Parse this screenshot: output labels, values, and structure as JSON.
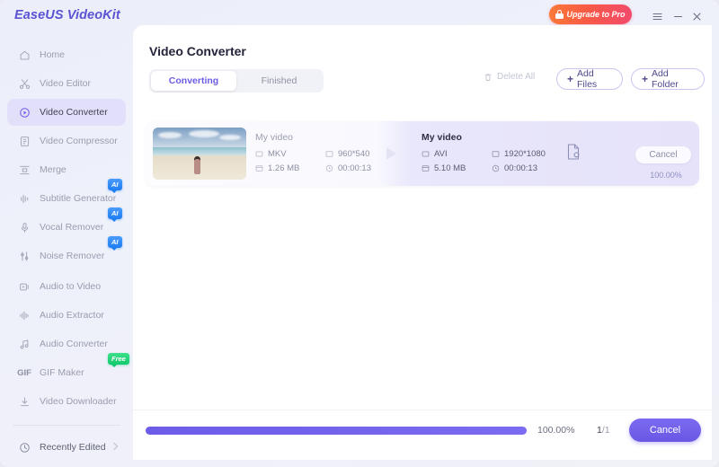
{
  "app": {
    "logo": "EaseUS VideoKit",
    "upgrade_label": "Upgrade to Pro"
  },
  "window_controls": {
    "menu": "menu-icon",
    "minimize": "minimize-icon",
    "close": "close-icon"
  },
  "sidebar": {
    "items": [
      {
        "label": "Home",
        "icon": "home-icon",
        "badge": null
      },
      {
        "label": "Video Editor",
        "icon": "scissors-icon",
        "badge": null
      },
      {
        "label": "Video Converter",
        "icon": "convert-icon",
        "badge": null
      },
      {
        "label": "Video Compressor",
        "icon": "compress-icon",
        "badge": null
      },
      {
        "label": "Merge",
        "icon": "merge-icon",
        "badge": null
      },
      {
        "label": "Subtitle Generator",
        "icon": "subtitle-icon",
        "badge": "AI"
      },
      {
        "label": "Vocal Remover",
        "icon": "microphone-icon",
        "badge": "AI"
      },
      {
        "label": "Noise Remover",
        "icon": "sliders-icon",
        "badge": "AI"
      },
      {
        "label": "Audio to Video",
        "icon": "audio-to-video-icon",
        "badge": null
      },
      {
        "label": "Audio Extractor",
        "icon": "waveform-icon",
        "badge": null
      },
      {
        "label": "Audio Converter",
        "icon": "music-note-icon",
        "badge": null
      },
      {
        "label": "GIF Maker",
        "icon": "gif-icon",
        "badge": "Free"
      },
      {
        "label": "Video Downloader",
        "icon": "download-icon",
        "badge": null
      }
    ],
    "footer_item": {
      "label": "Recently Edited",
      "icon": "clock-icon"
    }
  },
  "main": {
    "title": "Video Converter",
    "tabs": [
      {
        "label": "Converting",
        "active": true
      },
      {
        "label": "Finished",
        "active": false
      }
    ],
    "delete_all_label": "Delete All",
    "add_files_label": "Add Files",
    "add_folder_label": "Add Folder",
    "plus": "+"
  },
  "file_card": {
    "source": {
      "name": "My video",
      "format": "MKV",
      "resolution": "960*540",
      "size": "1.26 MB",
      "duration": "00:00:13"
    },
    "target": {
      "name": "My video",
      "format": "AVI",
      "resolution": "1920*1080",
      "size": "5.10 MB",
      "duration": "00:00:13"
    },
    "cancel_label": "Cancel",
    "percent_label": "100.00%",
    "settings_icon": "file-settings-icon",
    "arrow_icon": "arrow-right-icon",
    "thumbnail": "beach-video-thumbnail"
  },
  "footer": {
    "percent_label": "100.00%",
    "progress_value": 100,
    "count_label": "1",
    "count_total": "/1",
    "cancel_label": "Cancel"
  },
  "colors": {
    "accent": "#6c5ce7",
    "upgrade_start": "#fb7a38",
    "upgrade_end": "#f24a6e",
    "ai_badge": "#1f7ef0",
    "free_badge": "#12c96d"
  }
}
